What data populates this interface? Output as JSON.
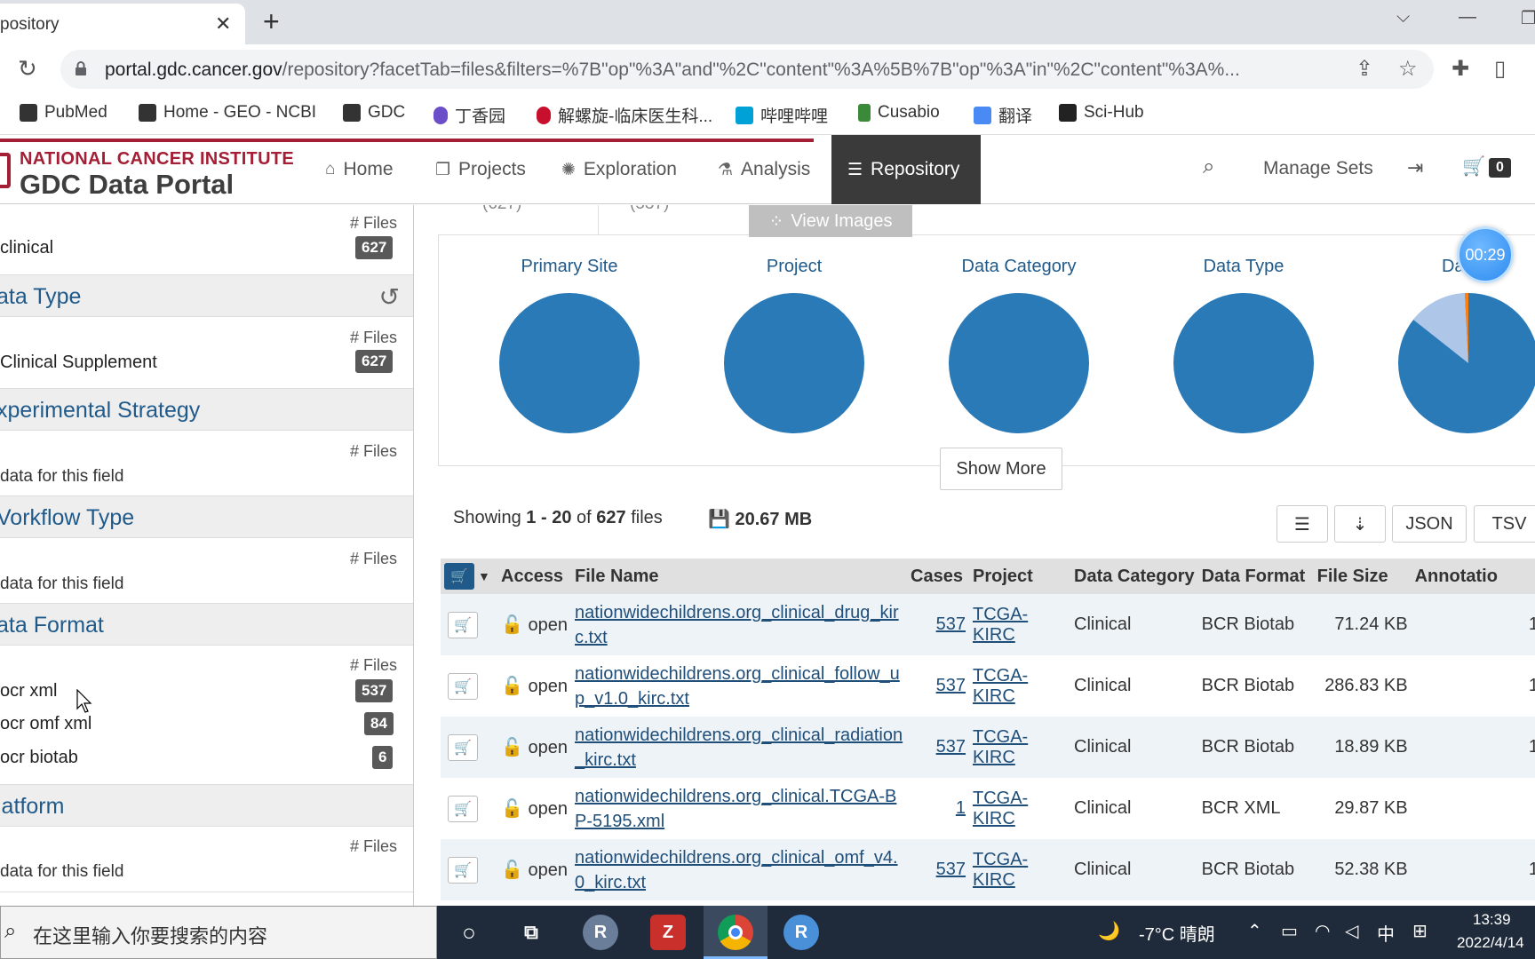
{
  "browser": {
    "tab_title": "pository",
    "url_host": "portal.gdc.cancer.gov",
    "url_path": "/repository?facetTab=files&filters=%7B\"op\"%3A\"and\"%2C\"content\"%3A%5B%7B\"op\"%3A\"in\"%2C\"content\"%3A%...",
    "bookmarks": [
      {
        "label": "PubMed",
        "icon": "bookmark-folder-icon"
      },
      {
        "label": "Home - GEO - NCBI",
        "icon": "bookmark-folder-icon"
      },
      {
        "label": "GDC",
        "icon": "bookmark-folder-icon"
      },
      {
        "label": "丁香园",
        "icon": "dxy-icon"
      },
      {
        "label": "解螺旋-临床医生科...",
        "icon": "jieluoxuan-icon"
      },
      {
        "label": "哔哩哔哩",
        "icon": "bilibili-icon"
      },
      {
        "label": "Cusabio",
        "icon": "cusabio-icon"
      },
      {
        "label": "翻译",
        "icon": "translate-icon"
      },
      {
        "label": "Sci-Hub",
        "icon": "scihub-icon"
      }
    ]
  },
  "gdc": {
    "nci": "NATIONAL CANCER INSTITUTE",
    "portal": "GDC Data Portal",
    "nav": {
      "home": "Home",
      "projects": "Projects",
      "exploration": "Exploration",
      "analysis": "Analysis",
      "repository": "Repository",
      "manage_sets": "Manage Sets",
      "cart_count": "0"
    }
  },
  "facets": {
    "files_label": "# Files",
    "no_data": "data for this field",
    "data_category": {
      "term": "clinical",
      "count": "627"
    },
    "data_type": {
      "title": "ata Type",
      "term": "Clinical Supplement",
      "count": "627"
    },
    "experimental_strategy": {
      "title": "xperimental Strategy"
    },
    "workflow_type": {
      "title": "Vorkflow Type"
    },
    "data_format": {
      "title": "ata Format",
      "terms": [
        {
          "term": "ocr xml",
          "count": "537"
        },
        {
          "term": "ocr omf xml",
          "count": "84"
        },
        {
          "term": "ocr biotab",
          "count": "6"
        }
      ]
    },
    "platform": {
      "title": "latform"
    }
  },
  "main": {
    "tab_counts": [
      "(627)",
      "(537)"
    ],
    "view_images": "View Images",
    "charts": [
      {
        "title": "Primary Site"
      },
      {
        "title": "Project"
      },
      {
        "title": "Data Category"
      },
      {
        "title": "Data Type"
      },
      {
        "title": "Data F"
      }
    ],
    "show_more": "Show More",
    "timer": "00:29",
    "summary": {
      "prefix": "Showing",
      "from": "1",
      "sep": "-",
      "to": "20",
      "of": "of",
      "total": "627",
      "suffix": "files",
      "size": "20.67 MB"
    },
    "buttons": {
      "json": "JSON",
      "tsv": "TSV"
    },
    "columns": [
      "Access",
      "File Name",
      "Cases",
      "Project",
      "Data Category",
      "Data Format",
      "File Size",
      "Annotatio"
    ],
    "rows": [
      {
        "access": "open",
        "file_name": "nationwidechildrens.org_clinical_drug_kirc.txt",
        "cases": "537",
        "project": "TCGA-KIRC",
        "category": "Clinical",
        "format": "BCR Biotab",
        "size": "71.24 KB",
        "annot": "1"
      },
      {
        "access": "open",
        "file_name": "nationwidechildrens.org_clinical_follow_up_v1.0_kirc.txt",
        "cases": "537",
        "project": "TCGA-KIRC",
        "category": "Clinical",
        "format": "BCR Biotab",
        "size": "286.83 KB",
        "annot": "1"
      },
      {
        "access": "open",
        "file_name": "nationwidechildrens.org_clinical_radiation_kirc.txt",
        "cases": "537",
        "project": "TCGA-KIRC",
        "category": "Clinical",
        "format": "BCR Biotab",
        "size": "18.89 KB",
        "annot": "1"
      },
      {
        "access": "open",
        "file_name": "nationwidechildrens.org_clinical.TCGA-BP-5195.xml",
        "cases": "1",
        "project": "TCGA-KIRC",
        "category": "Clinical",
        "format": "BCR XML",
        "size": "29.87 KB",
        "annot": ""
      },
      {
        "access": "open",
        "file_name": "nationwidechildrens.org_clinical_omf_v4.0_kirc.txt",
        "cases": "537",
        "project": "TCGA-KIRC",
        "category": "Clinical",
        "format": "BCR Biotab",
        "size": "52.38 KB",
        "annot": "1"
      }
    ]
  },
  "taskbar": {
    "search_placeholder": "在这里输入你要搜索的内容",
    "weather": "-7°C  晴朗",
    "ime": "中",
    "time": "13:39",
    "date": "2022/4/14"
  },
  "colors": {
    "accent": "#1f5a8a",
    "pie": "#2a7ab8",
    "nci_red": "#a41e35"
  }
}
